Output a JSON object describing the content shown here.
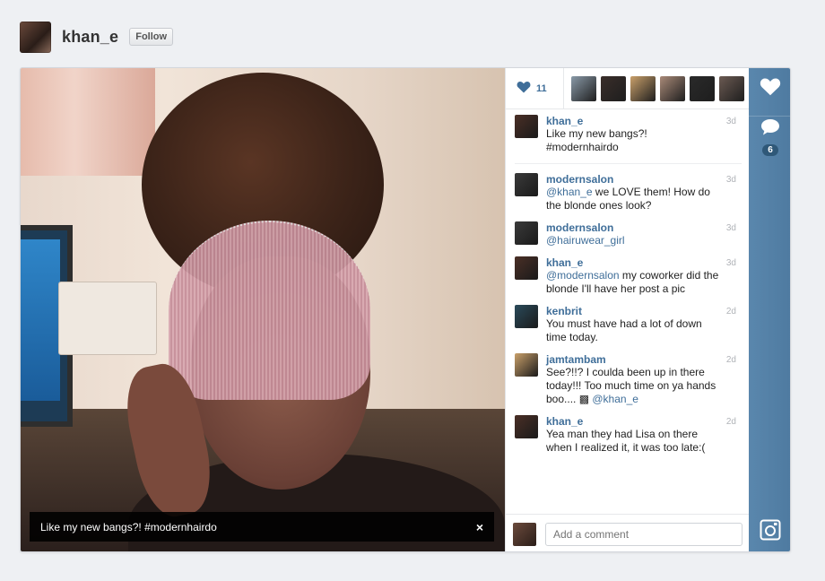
{
  "header": {
    "username": "khan_e",
    "follow_label": "Follow"
  },
  "photo": {
    "caption": "Like my new bangs?! #modernhairdo",
    "close_symbol": "×"
  },
  "likes": {
    "count": "11",
    "icon": "heart-icon",
    "likers": [
      "#8a9aa8",
      "#3a2e2a",
      "#c9a06a",
      "#a98a78",
      "#2a2a2a",
      "#6b5a52"
    ]
  },
  "comments": [
    {
      "user": "khan_e",
      "text": "Like my new bangs?! #modernhairdo",
      "time": "3d",
      "color": "#4a2f26"
    },
    {
      "user": "modernsalon",
      "mention": "@khan_e",
      "text": " we LOVE them! How do the blonde ones look?",
      "time": "3d",
      "color": "#3a3a3a"
    },
    {
      "user": "modernsalon",
      "mention": "@hairuwear_girl",
      "text": "",
      "time": "3d",
      "color": "#3a3a3a"
    },
    {
      "user": "khan_e",
      "mention": "@modernsalon",
      "text": " my coworker did the blonde I'll have her post a pic",
      "time": "3d",
      "color": "#4a2f26"
    },
    {
      "user": "kenbrit",
      "text": "You must have had a lot of down time today.",
      "time": "2d",
      "color": "#2a4a5a"
    },
    {
      "user": "jamtambam",
      "text": "See?!!? I coulda been up in there today!!! Too much time on ya hands boo.... ▩",
      "mention_after": " @khan_e",
      "time": "2d",
      "color": "#c9a06a"
    },
    {
      "user": "khan_e",
      "text": "Yea man they had Lisa on there when I realized it, it was too late:(",
      "time": "2d",
      "color": "#4a2f26"
    }
  ],
  "add_comment": {
    "placeholder": "Add a comment"
  },
  "rail": {
    "comment_count": "6"
  }
}
